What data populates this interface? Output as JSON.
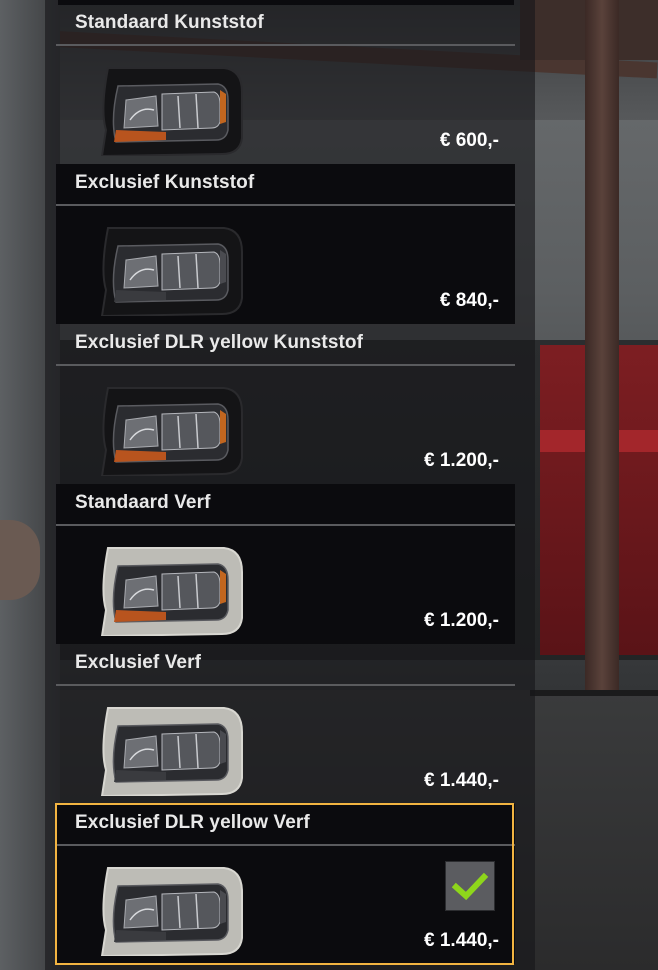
{
  "items": [
    {
      "label": "Standaard Kunststof",
      "price": "€ 600,-",
      "bezel": "plastic",
      "amber": true,
      "selected": false
    },
    {
      "label": "Exclusief Kunststof",
      "price": "€ 840,-",
      "bezel": "plastic",
      "amber": false,
      "selected": false
    },
    {
      "label": "Exclusief DLR yellow Kunststof",
      "price": "€ 1.200,-",
      "bezel": "plastic",
      "amber": true,
      "selected": false
    },
    {
      "label": "Standaard Verf",
      "price": "€ 1.200,-",
      "bezel": "painted",
      "amber": true,
      "selected": false
    },
    {
      "label": "Exclusief Verf",
      "price": "€ 1.440,-",
      "bezel": "painted",
      "amber": false,
      "selected": false
    },
    {
      "label": "Exclusief DLR yellow Verf",
      "price": "€ 1.440,-",
      "bezel": "painted",
      "amber": false,
      "selected": true
    }
  ],
  "colors": {
    "accent": "#f2b441",
    "check": "#8ed61b",
    "row_dark": "#0b0b0e"
  },
  "icons": {
    "selected": "checkmark-icon",
    "product": "headlight-icon"
  }
}
